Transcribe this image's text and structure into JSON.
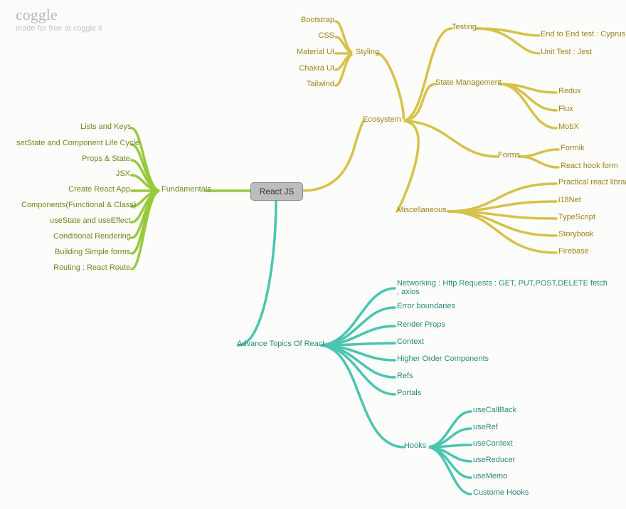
{
  "brand": {
    "logo": "coggle",
    "tagline": "made for free at coggle.it"
  },
  "root": {
    "title": "React JS"
  },
  "fundamentals": {
    "title": "Fundamentals",
    "items": [
      "Lists and Keys",
      "setState and Component Life Cycle",
      "Props & State",
      "JSX",
      "Create React App",
      "Components(Functional & Class)",
      "useState and useEffect",
      "Conditional Rendering",
      "Building Simple forms",
      "Routing : React Route"
    ]
  },
  "ecosystem": {
    "title": "Ecosystem",
    "styling": {
      "title": "Styling",
      "items": [
        "Bootstrap",
        "CSS",
        "Material UI",
        "Chakra UI",
        "Tailwind"
      ]
    },
    "testing": {
      "title": "Testing",
      "items": [
        "End to End test : Cyprus",
        "Unit Test : Jest"
      ]
    },
    "state": {
      "title": "State Management",
      "items": [
        "Redux",
        "Flux",
        "MobX"
      ]
    },
    "forms": {
      "title": "Forms",
      "items": [
        "Formik",
        "React hook form"
      ]
    },
    "misc": {
      "title": "Miscellaneous",
      "items": [
        "Practical react libraries",
        "i18Net",
        "TypeScript",
        "Storybook",
        "Firebase"
      ]
    }
  },
  "advance": {
    "title": "Advance Topics Of React",
    "items": [
      "Networking : Http Requests : GET, PUT,POST,DELETE fetch , axios",
      "Error boundaries",
      "Render Props",
      "Context",
      "Higher Order Components",
      "Refs",
      "Portals"
    ],
    "hooks": {
      "title": "Hooks",
      "items": [
        "useCallBack",
        "useRef",
        "useContext",
        "useReducer",
        "useMemo",
        "Custome Hooks"
      ]
    }
  }
}
